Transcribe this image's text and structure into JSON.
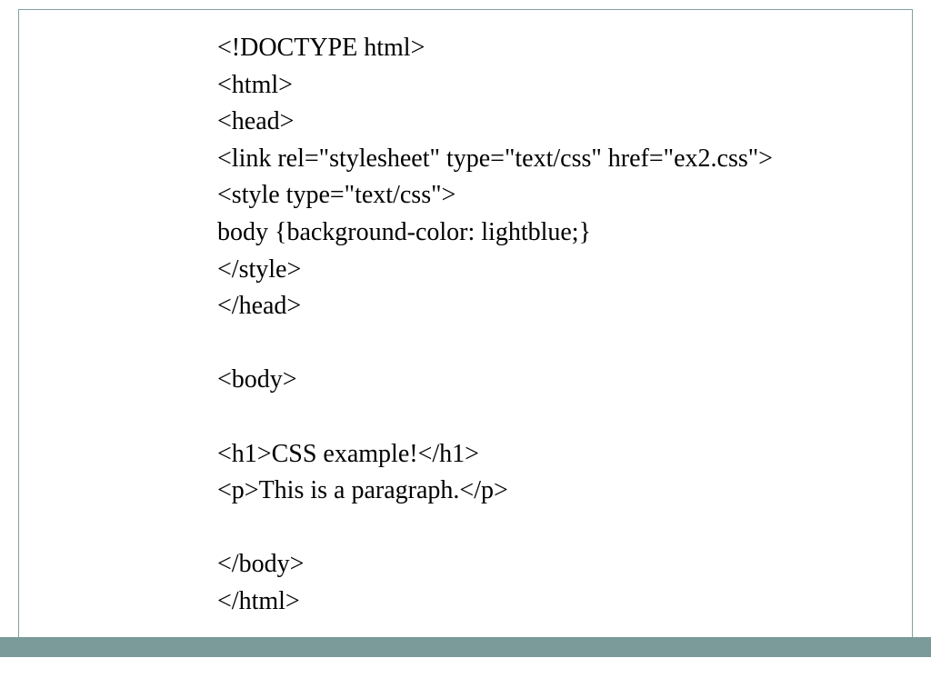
{
  "code": {
    "lines": [
      "<!DOCTYPE html>",
      "<html>",
      "<head>",
      "<link rel=\"stylesheet\" type=\"text/css\" href=\"ex2.css\">",
      "<style type=\"text/css\">",
      "body {background-color: lightblue;}",
      "</style>",
      "</head>",
      "",
      "<body>",
      "",
      "<h1>CSS example!</h1>",
      "<p>This is a paragraph.</p>",
      "",
      "</body>",
      "</html>"
    ]
  },
  "colors": {
    "border": "#7fa3a3",
    "footer": "#7b9a9a"
  }
}
